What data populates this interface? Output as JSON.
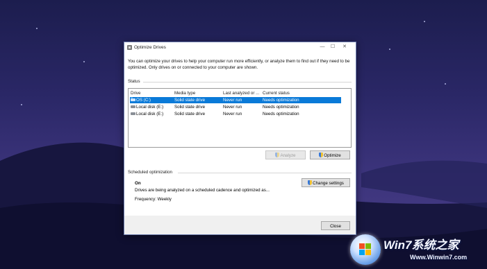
{
  "window": {
    "title": "Optimize Drives",
    "minimize_glyph": "—",
    "maximize_glyph": "☐",
    "close_glyph": "✕"
  },
  "intro_text": "You can optimize your drives to help your computer run more efficiently, or analyze them to find out if they need to be optimized. Only drives on or connected to your computer are shown.",
  "status": {
    "label": "Status",
    "columns": [
      "Drive",
      "Media type",
      "Last analyzed or ...",
      "Current status"
    ],
    "rows": [
      {
        "drive": "OS (C:)",
        "media": "Solid state drive",
        "last": "Never run",
        "status": "Needs optimization",
        "selected": true
      },
      {
        "drive": "Local disk (E:)",
        "media": "Solid state drive",
        "last": "Never run",
        "status": "Needs optimization",
        "selected": false
      },
      {
        "drive": "Local disk (E:)",
        "media": "Solid state drive",
        "last": "Never run",
        "status": "Needs optimization",
        "selected": false
      }
    ]
  },
  "buttons": {
    "analyze": "Analyze",
    "optimize": "Optimize",
    "change_settings": "Change settings",
    "close": "Close"
  },
  "scheduled": {
    "label": "Scheduled optimization",
    "state": "On",
    "description": "Drives are being analyzed on a scheduled cadence and optimized as...",
    "frequency": "Frequency: Weekly"
  },
  "watermark": {
    "title": "Win7系统之家",
    "url": "Www.Winwin7.com"
  },
  "colors": {
    "selection": "#0a7ad8",
    "window_border": "#6f7fb0"
  }
}
